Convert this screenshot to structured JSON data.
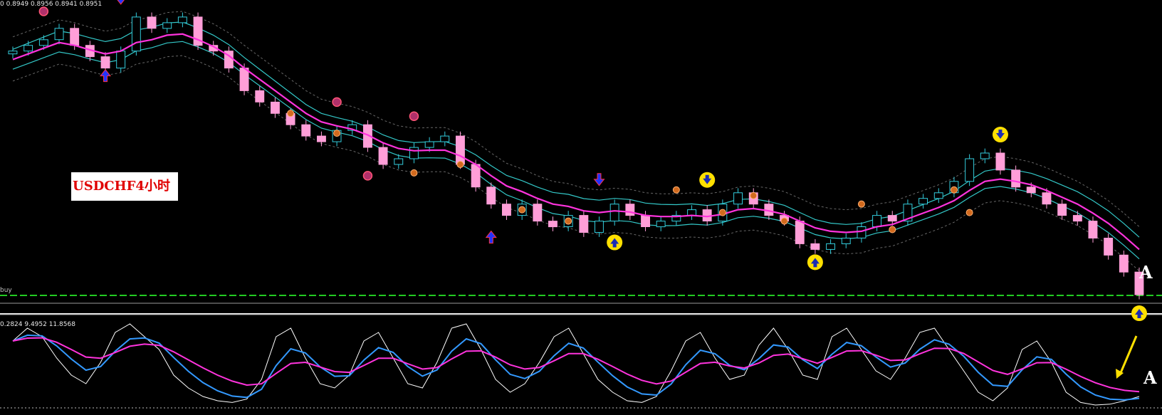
{
  "header": {
    "ohlc_text": "0 0.8949 0.8956 0.8941 0.8951",
    "indicator_text": "0.2824 9.4952 11.8568",
    "buy_label": "buy"
  },
  "annotation": {
    "symbol_label": "USDCHF4小时",
    "mark_main": "A",
    "mark_indicator": "A"
  },
  "colors": {
    "background": "#000000",
    "bull_candle": "#33ccdd",
    "bear_candle": "#ff9ed8",
    "ma_magenta": "#ff33dd",
    "envelope_cyan": "#33c8c8",
    "dotted_band": "#666666",
    "buy_line": "#22cc22",
    "osc_white": "#ffffff",
    "osc_blue": "#3399ff",
    "osc_magenta": "#ff33dd",
    "arrow_yellow": "#ffe000",
    "arrow_blue": "#2233ff"
  },
  "chart_data": {
    "type": "line",
    "main_close": [
      0.899,
      0.9,
      0.901,
      0.903,
      0.9,
      0.898,
      0.896,
      0.899,
      0.905,
      0.903,
      0.904,
      0.905,
      0.9,
      0.899,
      0.896,
      0.892,
      0.89,
      0.888,
      0.886,
      0.884,
      0.883,
      0.885,
      0.886,
      0.882,
      0.879,
      0.88,
      0.882,
      0.883,
      0.884,
      0.879,
      0.875,
      0.872,
      0.87,
      0.872,
      0.869,
      0.868,
      0.87,
      0.867,
      0.869,
      0.872,
      0.87,
      0.868,
      0.869,
      0.87,
      0.871,
      0.869,
      0.872,
      0.874,
      0.872,
      0.87,
      0.869,
      0.865,
      0.864,
      0.865,
      0.866,
      0.868,
      0.87,
      0.869,
      0.872,
      0.873,
      0.874,
      0.876,
      0.88,
      0.881,
      0.878,
      0.875,
      0.874,
      0.872,
      0.87,
      0.869,
      0.866,
      0.863,
      0.86,
      0.856
    ],
    "main_ma": [
      0.8975,
      0.8985,
      0.8995,
      0.9005,
      0.9,
      0.8992,
      0.8985,
      0.899,
      0.9005,
      0.901,
      0.9018,
      0.902,
      0.901,
      0.8998,
      0.8982,
      0.896,
      0.894,
      0.892,
      0.89,
      0.888,
      0.8865,
      0.8858,
      0.8852,
      0.8842,
      0.8828,
      0.8818,
      0.8814,
      0.8815,
      0.8815,
      0.8805,
      0.879,
      0.877,
      0.8752,
      0.8742,
      0.873,
      0.872,
      0.8716,
      0.8708,
      0.8705,
      0.8708,
      0.8706,
      0.87,
      0.8698,
      0.8698,
      0.87,
      0.8698,
      0.8702,
      0.871,
      0.8712,
      0.8708,
      0.8702,
      0.869,
      0.8678,
      0.8672,
      0.867,
      0.8672,
      0.868,
      0.8684,
      0.8694,
      0.8704,
      0.8714,
      0.8726,
      0.8744,
      0.876,
      0.8764,
      0.876,
      0.8754,
      0.8744,
      0.8732,
      0.872,
      0.8704,
      0.8686,
      0.8664,
      0.864
    ],
    "oscillator_k": [
      80,
      95,
      85,
      60,
      40,
      30,
      55,
      90,
      100,
      85,
      70,
      40,
      25,
      15,
      10,
      8,
      12,
      35,
      85,
      95,
      60,
      30,
      25,
      40,
      80,
      90,
      60,
      30,
      25,
      55,
      95,
      100,
      70,
      35,
      20,
      30,
      55,
      85,
      95,
      65,
      35,
      20,
      10,
      8,
      15,
      45,
      80,
      90,
      60,
      35,
      40,
      75,
      95,
      70,
      40,
      35,
      85,
      95,
      70,
      45,
      35,
      60,
      90,
      95,
      70,
      45,
      20,
      10,
      25,
      70,
      80,
      55,
      20,
      8,
      5,
      6,
      10,
      15
    ]
  }
}
